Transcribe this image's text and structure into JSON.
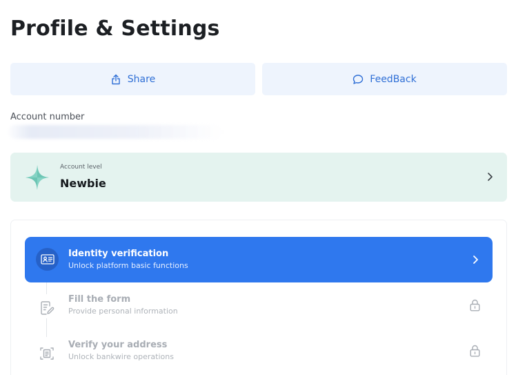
{
  "page": {
    "title": "Profile & Settings"
  },
  "actions": {
    "share_label": "Share",
    "feedback_label": "FeedBack"
  },
  "account": {
    "number_label": "Account number"
  },
  "level": {
    "caption": "Account level",
    "value": "Newbie"
  },
  "steps": [
    {
      "title": "Identity verification",
      "subtitle": "Unlock platform basic functions",
      "state": "active",
      "icon": "id-card-icon"
    },
    {
      "title": "Fill the form",
      "subtitle": "Provide personal information",
      "state": "locked",
      "icon": "form-edit-icon"
    },
    {
      "title": "Verify your address",
      "subtitle": "Unlock bankwire operations",
      "state": "locked",
      "icon": "address-document-icon"
    }
  ],
  "colors": {
    "primary": "#2f78ee",
    "action_bg": "#eef4fd",
    "level_bg": "#e4f3ef",
    "level_star": "#7fcfc0"
  }
}
